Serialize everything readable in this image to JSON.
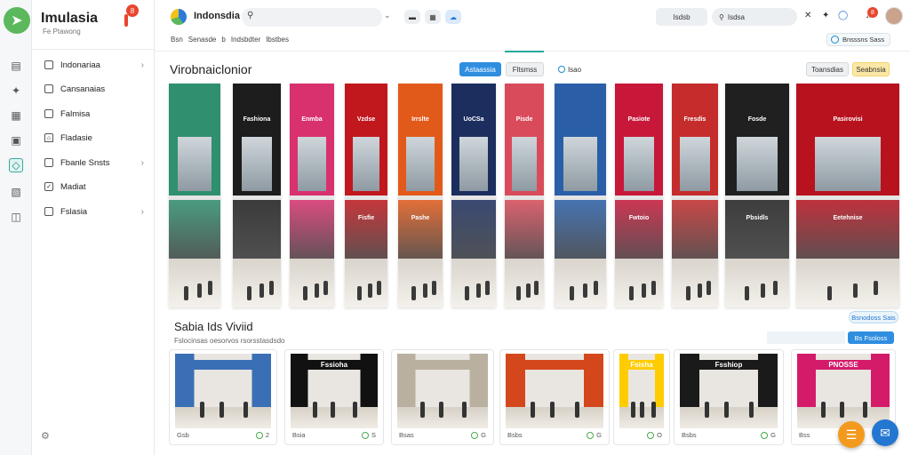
{
  "app": {
    "brand_name": "Imulasia",
    "brand_badge": "8",
    "brand_sub": "Fe    Ptawong",
    "bottom_icon": "settings-gear-icon"
  },
  "rail": {
    "icons": [
      "layers-icon",
      "puzzle-icon",
      "document-icon",
      "image-icon",
      "tag-icon",
      "copy-icon",
      "grid-icon"
    ]
  },
  "sidebar": {
    "items": [
      {
        "label": "Indonariaa",
        "has_chevron": true
      },
      {
        "label": "Cansanaias",
        "has_chevron": false
      },
      {
        "label": "Falmisa",
        "has_chevron": false
      },
      {
        "label": "Fladasie",
        "has_chevron": false
      },
      {
        "label": "Fbanle Snsts",
        "has_chevron": true
      },
      {
        "label": "Madiat",
        "has_chevron": false
      },
      {
        "label": "Fslasia",
        "has_chevron": true
      }
    ]
  },
  "topbar": {
    "title": "Indonsdia",
    "search_placeholder": "",
    "pill_label": "Isdsb",
    "search2_label": "Isdsa",
    "notification_count": "8"
  },
  "breadcrumb": {
    "items": [
      "Bsn",
      "Senasde",
      "b",
      "Indsbdter",
      "Ibstbes"
    ],
    "right_label": "Bnsssns Sass"
  },
  "header": {
    "title": "Virobnaiclonior",
    "tab_primary": "Astaassia",
    "tab_secondary": "Fltsmss",
    "tab_link": "Isao",
    "action_gray": "Toansdias",
    "action_yellow": "Seabnsia"
  },
  "gallery": {
    "panels": [
      {
        "sign": "",
        "color": "#2f8f6e",
        "sign2": ""
      },
      {
        "sign": "Fashiona",
        "color": "#1d1d1d",
        "sign2": ""
      },
      {
        "sign": "Enmba",
        "color": "#d8316e",
        "sign2": ""
      },
      {
        "sign": "Vzdse",
        "color": "#c0181d",
        "sign2": "Fisfie"
      },
      {
        "sign": "Irrslte",
        "color": "#e25a1a",
        "sign2": "Pashe"
      },
      {
        "sign": "UoCSa",
        "color": "#1c2e5e",
        "sign2": ""
      },
      {
        "sign": "Pisde",
        "color": "#d94b5a",
        "sign2": ""
      },
      {
        "sign": "",
        "color": "#2a5fa8",
        "sign2": ""
      },
      {
        "sign": "Pasiote",
        "color": "#c7183a",
        "sign2": "Fwtoio"
      },
      {
        "sign": "Fresdis",
        "color": "#c52c2c",
        "sign2": ""
      },
      {
        "sign": "Fosde",
        "color": "#202020",
        "sign2": "Pbsidls"
      },
      {
        "sign": "Pasirovisi",
        "color": "#b8121f",
        "sign2": "Eetehnise"
      }
    ]
  },
  "section2": {
    "title": "Sabia Ids Viviid",
    "subtitle": "Fslocinsas oesorvos rsorsstasdsdo",
    "button_top": "Bsnodoss Sais",
    "button_blue": "Bs Fsoloss",
    "cards": [
      {
        "label": "Gsb",
        "meta": "2",
        "sign": "",
        "color": "#3a6fb5"
      },
      {
        "label": "Bsia",
        "meta": "S",
        "sign": "Fssioha",
        "color": "#111111"
      },
      {
        "label": "Bsas",
        "meta": "G",
        "sign": "",
        "color": "#b9b0a0"
      },
      {
        "label": "Bsbs",
        "meta": "G",
        "sign": "",
        "color": "#d4471c"
      },
      {
        "label": "",
        "meta": "O",
        "sign": "Fsisha",
        "color": "#ffcc00"
      },
      {
        "label": "Bsbs",
        "meta": "G",
        "sign": "Fsshiop",
        "color": "#1a1a1a"
      },
      {
        "label": "Bss",
        "meta": "G",
        "sign": "PNOSSE",
        "color": "#d41b6a"
      }
    ]
  },
  "fab": {
    "orange_icon": "filter-icon",
    "blue_icon": "chat-icon"
  }
}
